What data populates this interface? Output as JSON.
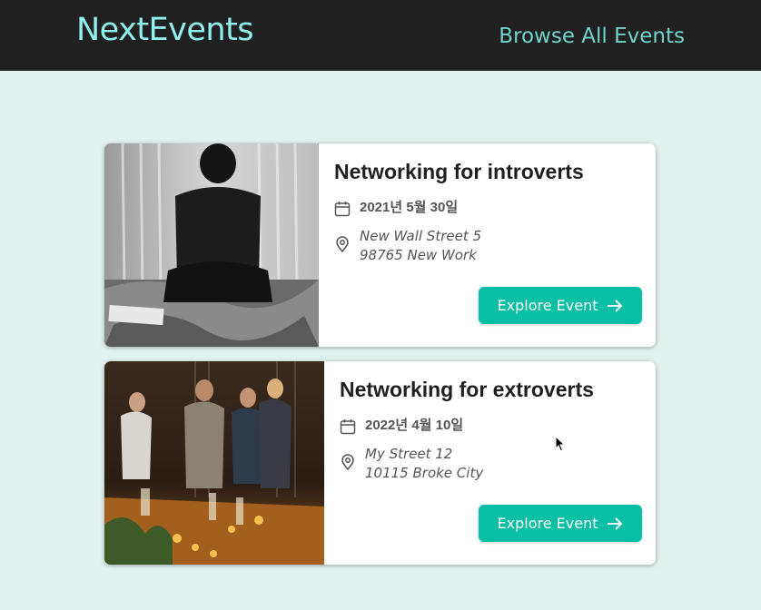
{
  "header": {
    "logo": "NextEvents",
    "nav_link": "Browse All Events",
    "bg_color": "#202020",
    "logo_color": "#8ff2ee",
    "link_color": "#6fd3c9"
  },
  "page_bg": "#e2f2ef",
  "events": [
    {
      "title": "Networking for introverts",
      "date": "2021년 5월 30일",
      "address_line1": "New Wall Street 5",
      "address_line2": "98765 New Work",
      "button_label": "Explore Event",
      "date_icon": "calendar-icon",
      "address_icon": "location-pin-icon",
      "button_icon": "arrow-right-icon"
    },
    {
      "title": "Networking for extroverts",
      "date": "2022년 4월 10일",
      "address_line1": "My Street 12",
      "address_line2": "10115 Broke City",
      "button_label": "Explore Event",
      "date_icon": "calendar-icon",
      "address_icon": "location-pin-icon",
      "button_icon": "arrow-right-icon"
    }
  ],
  "accent_color": "#06bfa4"
}
